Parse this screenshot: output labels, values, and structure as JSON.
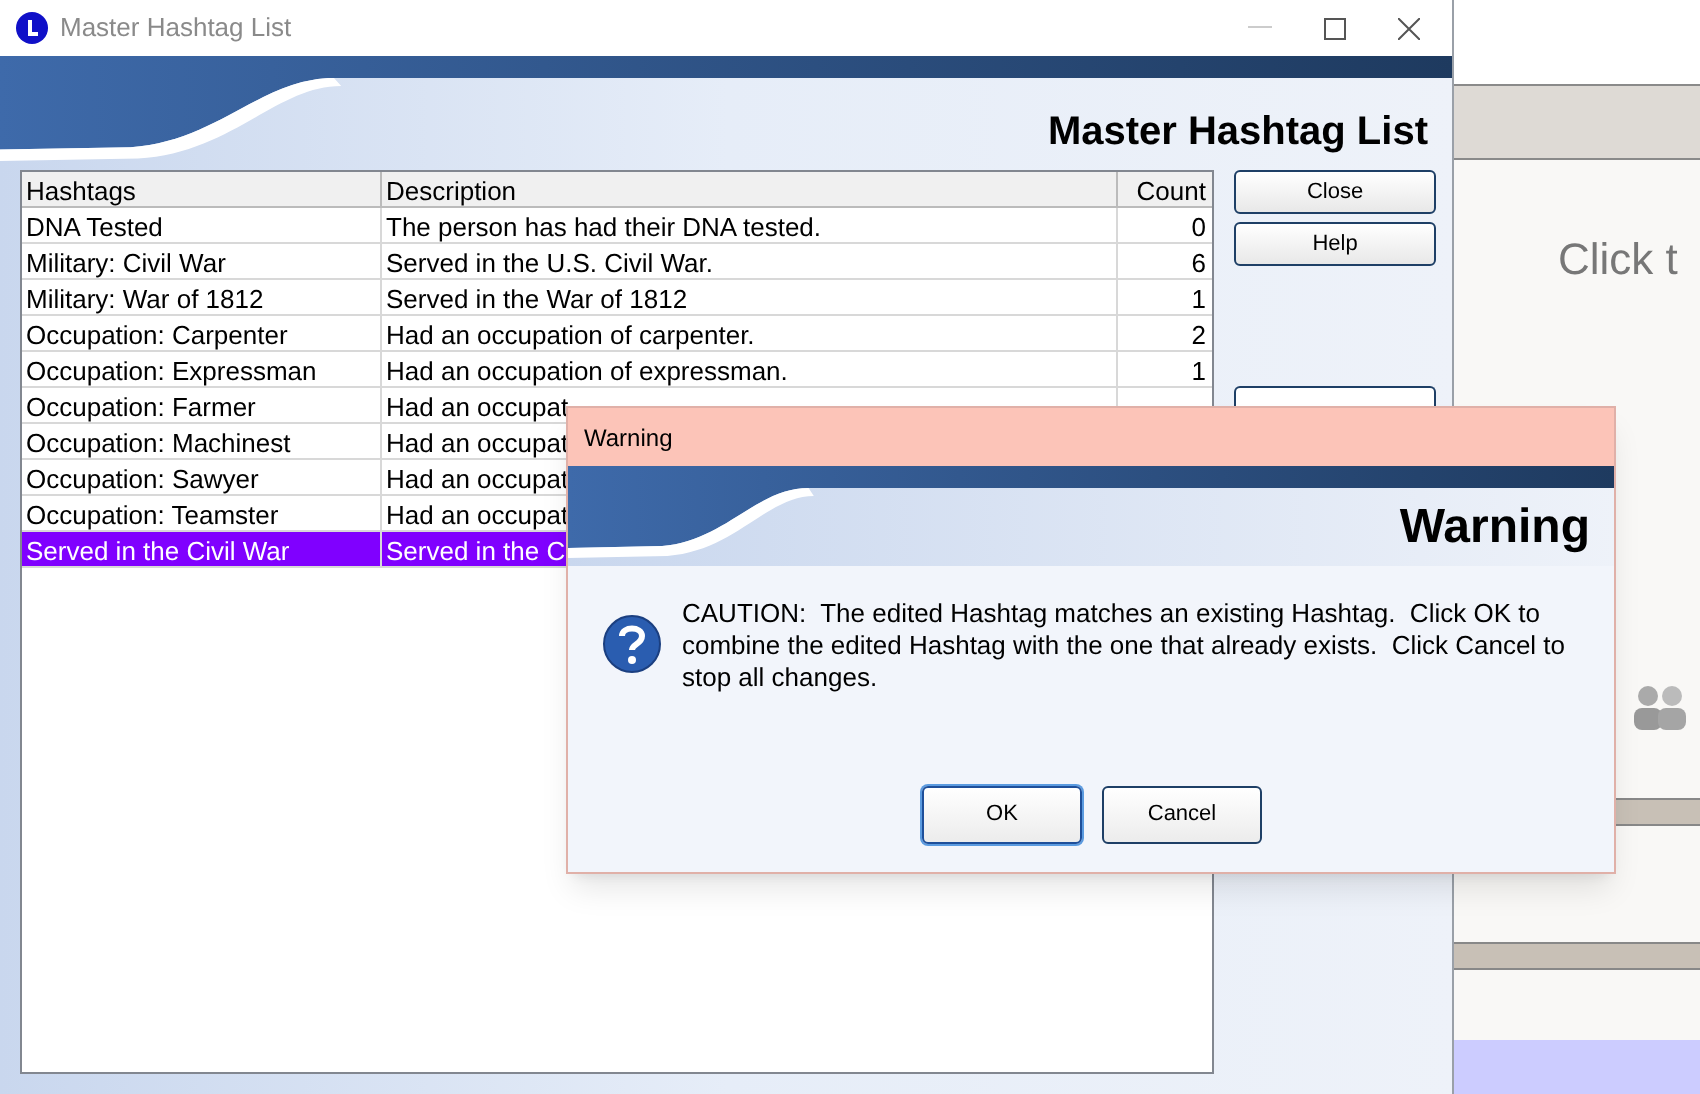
{
  "window": {
    "title": "Master Hashtag List",
    "heading": "Master Hashtag List"
  },
  "table": {
    "columns": [
      "Hashtags",
      "Description",
      "Count"
    ],
    "rows": [
      {
        "hashtag": "DNA Tested",
        "description": "The person has had their DNA tested.",
        "count": "0",
        "selected": false
      },
      {
        "hashtag": "Military: Civil War",
        "description": "Served in the U.S. Civil War.",
        "count": "6",
        "selected": false
      },
      {
        "hashtag": "Military: War of 1812",
        "description": "Served in the War of 1812",
        "count": "1",
        "selected": false
      },
      {
        "hashtag": "Occupation: Carpenter",
        "description": "Had an occupation of carpenter.",
        "count": "2",
        "selected": false
      },
      {
        "hashtag": "Occupation: Expressman",
        "description": "Had an occupation of expressman.",
        "count": "1",
        "selected": false
      },
      {
        "hashtag": "Occupation: Farmer",
        "description": "Had an occupat",
        "selected": false
      },
      {
        "hashtag": "Occupation: Machinest",
        "description": "Had an occupat",
        "selected": false
      },
      {
        "hashtag": "Occupation: Sawyer",
        "description": "Had an occupat",
        "selected": false
      },
      {
        "hashtag": "Occupation: Teamster",
        "description": "Had an occupat",
        "selected": false
      },
      {
        "hashtag": "Served in the Civil War",
        "description": "Served in the C",
        "selected": true
      }
    ]
  },
  "buttons": [
    "Close",
    "Help"
  ],
  "background_app": {
    "text": "Click t"
  },
  "dialog": {
    "title": "Warning",
    "heading": "Warning",
    "message": "CAUTION:  The edited Hashtag matches an existing Hashtag.  Click OK to combine the edited Hashtag with the one that already exists.  Click Cancel to stop all changes.",
    "buttons": [
      {
        "label": "OK",
        "default": true
      },
      {
        "label": "Cancel",
        "default": false
      }
    ]
  }
}
